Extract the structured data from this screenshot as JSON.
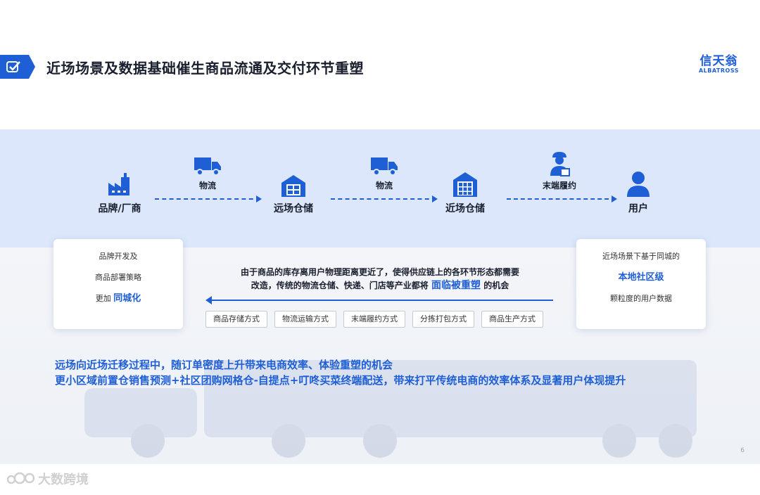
{
  "header": {
    "title": "近场场景及数据基础催生商品流通及交付环节重塑",
    "logo_cn": "信天翁",
    "logo_en": "ALBATROSS"
  },
  "flow": {
    "nodes": [
      {
        "label": "品牌/厂商",
        "icon": "factory-icon"
      },
      {
        "label": "远场仓储",
        "icon": "warehouse-icon"
      },
      {
        "label": "近场仓储",
        "icon": "store-warehouse-icon"
      },
      {
        "label": "用户",
        "icon": "user-icon"
      }
    ],
    "links": [
      {
        "label": "物流",
        "icon": "truck-icon"
      },
      {
        "label": "物流",
        "icon": "truck-icon"
      },
      {
        "label": "末端履约",
        "icon": "courier-icon"
      }
    ]
  },
  "left_card": {
    "line1": "品牌开发及",
    "line2": "商品部署策略",
    "line3_prefix": "更加",
    "line3_highlight": "同城化"
  },
  "right_card": {
    "line1": "近场场景下基于同城的",
    "line2": "本地社区级",
    "line3": "颗粒度的用户数据"
  },
  "center": {
    "text1": "由于商品的库存离用户物理距离更近了，使得供应链上的各环节形态都需要",
    "text2_prefix": "改造，传统的物流仓储、快递、门店等产业都将",
    "text2_highlight": "面临被重塑",
    "text2_suffix": "的机会",
    "tags": [
      "商品存储方式",
      "物流运输方式",
      "末端履约方式",
      "分拣打包方式",
      "商品生产方式"
    ]
  },
  "bottom": {
    "line1": "远场向近场迁移过程中，随订单密度上升带来电商效率、体验重塑的机会",
    "line2": "更小区域前置仓销售预测+社区团购网格仓-自提点+叮咚买菜终端配送，带来打平传统电商的效率体系及显著用户体现提升"
  },
  "page_number": "6",
  "watermark": "大数跨境",
  "colors": {
    "accent": "#1f5fd6",
    "band": "#dce7fb"
  }
}
